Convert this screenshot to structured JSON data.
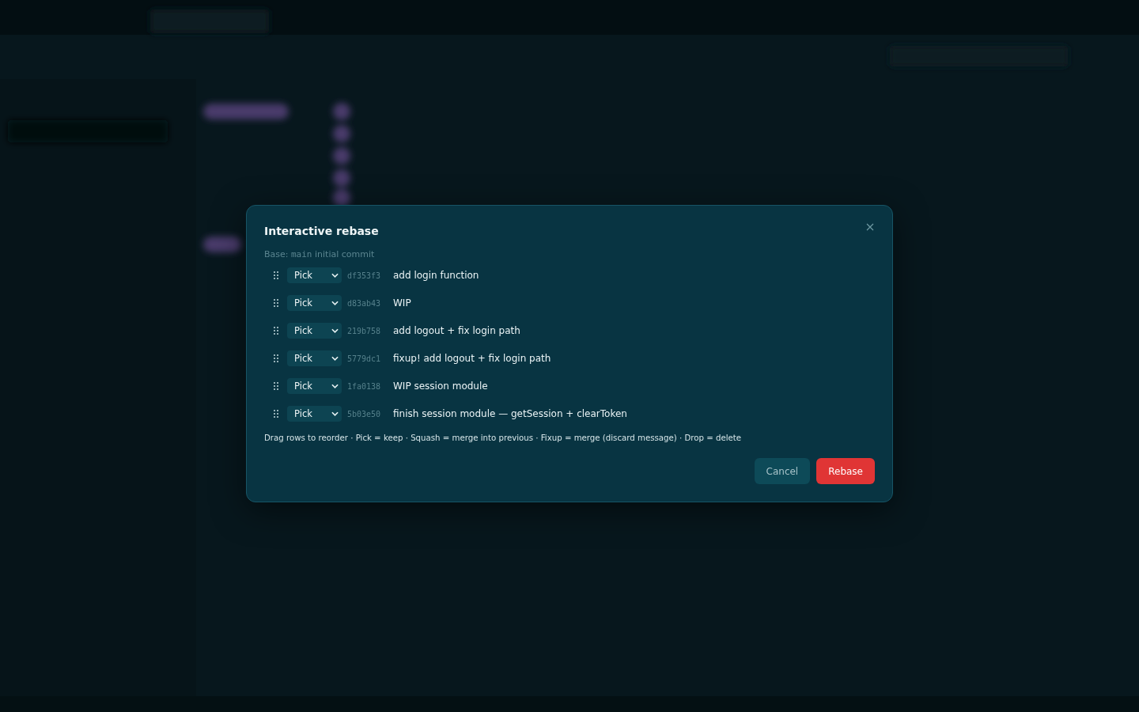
{
  "dialog": {
    "title": "Interactive rebase",
    "base": {
      "label": "Base:",
      "ref": "main",
      "message": "initial commit"
    },
    "commits": [
      {
        "action": "Pick",
        "hash": "df353f3",
        "message": "add login function"
      },
      {
        "action": "Pick",
        "hash": "d83ab43",
        "message": "WIP"
      },
      {
        "action": "Pick",
        "hash": "219b758",
        "message": "add logout + fix login path"
      },
      {
        "action": "Pick",
        "hash": "5779dc1",
        "message": "fixup! add logout + fix login path"
      },
      {
        "action": "Pick",
        "hash": "1fa0138",
        "message": "WIP session module"
      },
      {
        "action": "Pick",
        "hash": "5b03e50",
        "message": "finish session module — getSession + clearToken"
      }
    ],
    "hint": "Drag rows to reorder · Pick = keep · Squash = merge into previous · Fixup = merge (discard message) · Drop = delete",
    "buttons": [
      {
        "label": "Cancel",
        "kind": "secondary"
      },
      {
        "label": "Rebase",
        "kind": "primary"
      }
    ]
  }
}
